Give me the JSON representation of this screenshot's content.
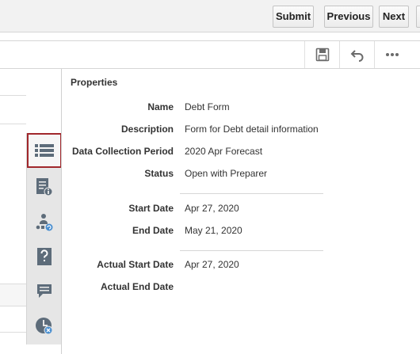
{
  "nav": {
    "submit": "Submit",
    "previous": "Previous",
    "next": "Next"
  },
  "toolbar": {
    "icons": [
      "save-icon",
      "undo-icon",
      "more-icon"
    ]
  },
  "strip": {
    "icons": [
      "properties-list-icon",
      "instructions-icon",
      "workflow-icon",
      "questions-icon",
      "comments-icon",
      "history-icon"
    ],
    "selected": "properties-list-icon",
    "accent": "#a0272c",
    "icon_color": "#5d6c7a"
  },
  "properties": {
    "title": "Properties",
    "name_label": "Name",
    "name_value": "Debt Form",
    "description_label": "Description",
    "description_value": "Form for Debt detail information",
    "period_label": "Data Collection Period",
    "period_value": "2020 Apr Forecast",
    "status_label": "Status",
    "status_value": "Open with Preparer",
    "start_date_label": "Start Date",
    "start_date_value": "Apr 27, 2020",
    "end_date_label": "End Date",
    "end_date_value": "May 21, 2020",
    "actual_start_label": "Actual Start Date",
    "actual_start_value": "Apr 27, 2020",
    "actual_end_label": "Actual End Date",
    "actual_end_value": ""
  }
}
